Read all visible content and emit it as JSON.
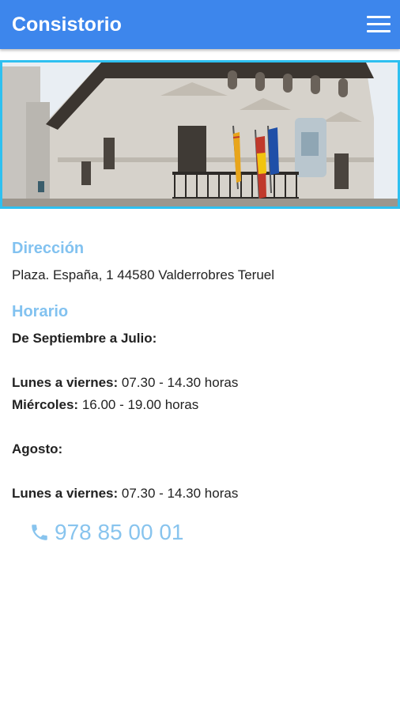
{
  "appbar": {
    "title": "Consistorio",
    "menu_icon": "hamburger-menu-icon"
  },
  "hero": {
    "image": "town-hall-building-photo",
    "border_color": "#2ec0f0"
  },
  "address": {
    "heading": "Dirección",
    "text": "Plaza. España, 1 44580 Valderrobres Teruel"
  },
  "schedule": {
    "heading": "Horario",
    "period1_title": "De Septiembre a Julio:",
    "period1_line1_label": "Lunes a viernes:",
    "period1_line1_value": " 07.30 - 14.30 horas",
    "period1_line2_label": "Miércoles:",
    "period1_line2_value": " 16.00 - 19.00 horas",
    "period2_title": "Agosto:",
    "period2_line1_label": "Lunes a viernes:",
    "period2_line1_value": " 07.30 - 14.30 horas"
  },
  "phone": {
    "icon": "phone-icon",
    "number": "978 85 00 01"
  },
  "colors": {
    "appbar": "#3d86ec",
    "accent_text": "#82c2f0"
  }
}
